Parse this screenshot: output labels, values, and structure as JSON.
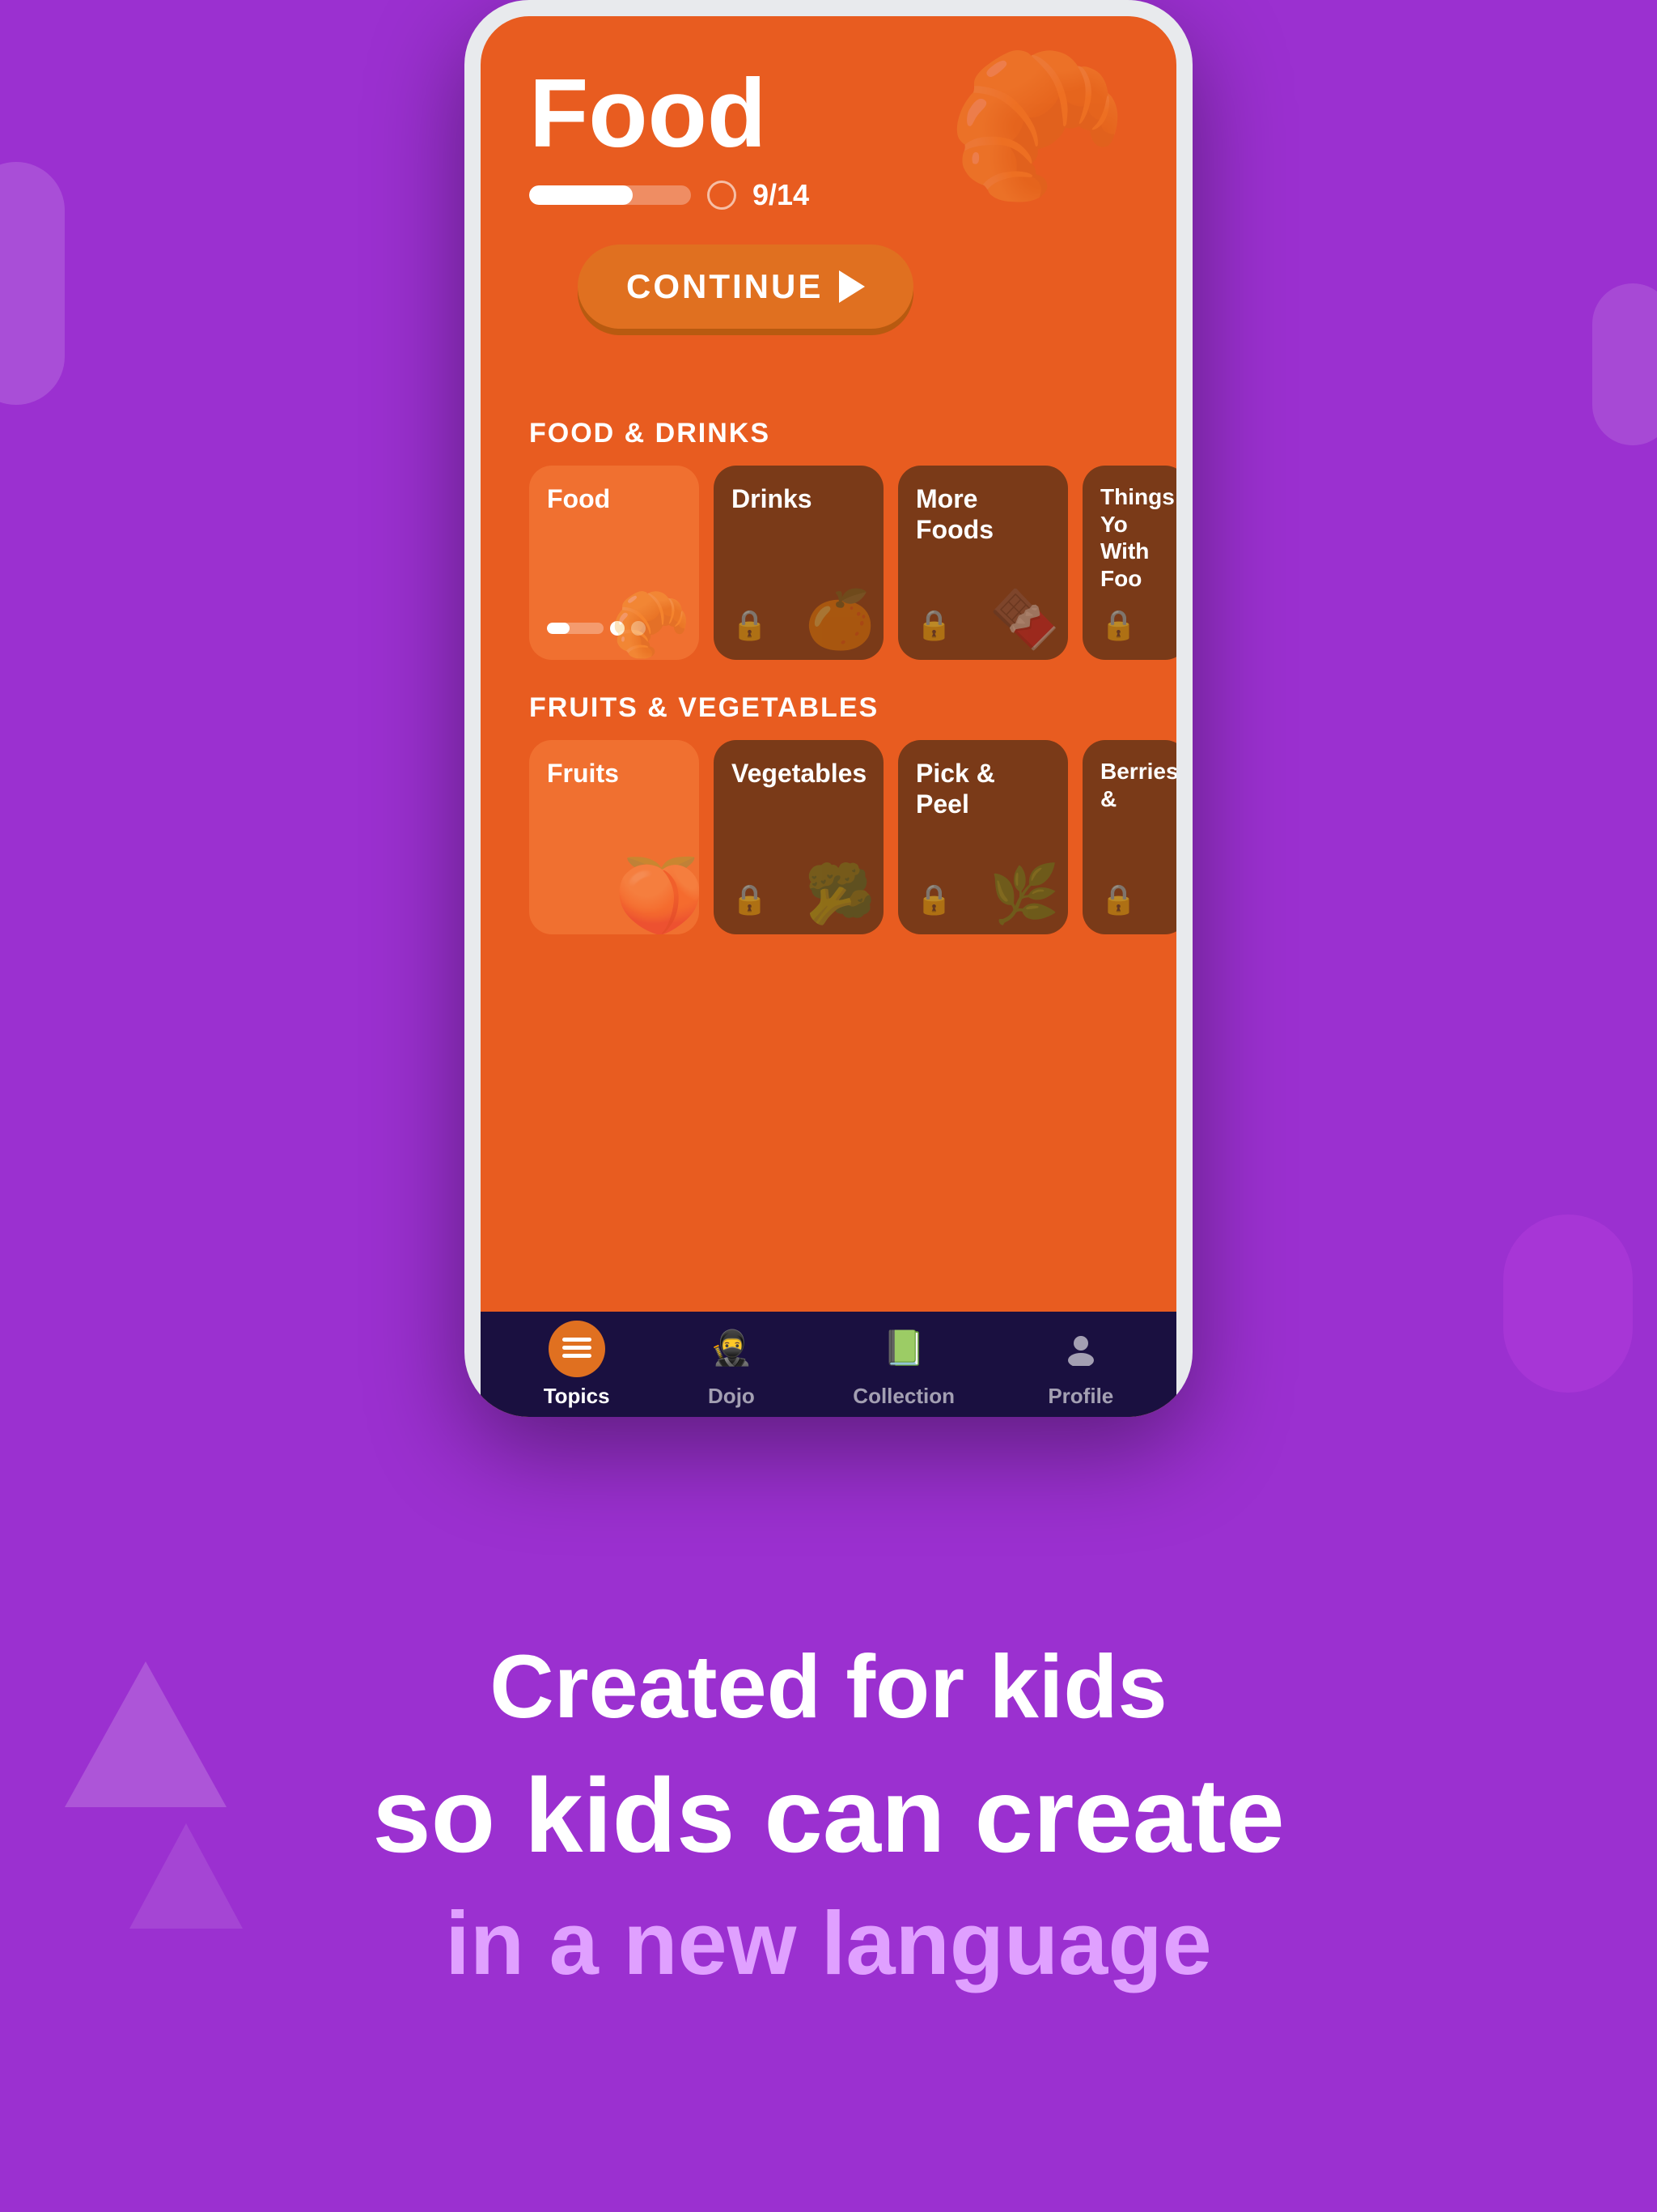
{
  "app": {
    "title": "Food",
    "progress": {
      "current": 9,
      "total": 14,
      "label": "9/14",
      "percent": 64
    },
    "continue_btn": "CONTINUE",
    "sections": [
      {
        "id": "food-drinks",
        "label": "FOOD & DRINKS",
        "cards": [
          {
            "id": "food",
            "title": "Food",
            "locked": false,
            "has_progress": true
          },
          {
            "id": "drinks",
            "title": "Drinks",
            "locked": true
          },
          {
            "id": "more-foods",
            "title": "More Foods",
            "locked": true
          },
          {
            "id": "things-you-do",
            "title": "Things You Do With Food",
            "locked": true
          }
        ]
      },
      {
        "id": "fruits-vegetables",
        "label": "FRUITS & VEGETABLES",
        "cards": [
          {
            "id": "fruits",
            "title": "Fruits",
            "locked": false,
            "has_progress": false
          },
          {
            "id": "vegetables",
            "title": "Vegetables",
            "locked": true
          },
          {
            "id": "pick-peel",
            "title": "Pick & Peel",
            "locked": true
          },
          {
            "id": "berries",
            "title": "Berries &",
            "locked": true
          }
        ]
      }
    ],
    "bottom_nav": [
      {
        "id": "topics",
        "label": "Topics",
        "active": true,
        "icon": "list"
      },
      {
        "id": "dojo",
        "label": "Dojo",
        "active": false,
        "icon": "ninja"
      },
      {
        "id": "collection",
        "label": "Collection",
        "active": false,
        "icon": "book"
      },
      {
        "id": "profile",
        "label": "Profile",
        "active": false,
        "icon": "person"
      }
    ]
  },
  "tagline": {
    "line1": "Created for kids",
    "line2": "so kids can create",
    "line3": "in a new language"
  },
  "colors": {
    "bg_purple": "#9b30d0",
    "app_orange": "#e85c20",
    "card_active": "#f07030",
    "card_locked": "#7a3a18",
    "nav_bg": "#1a1040",
    "btn_orange": "#e07020"
  }
}
